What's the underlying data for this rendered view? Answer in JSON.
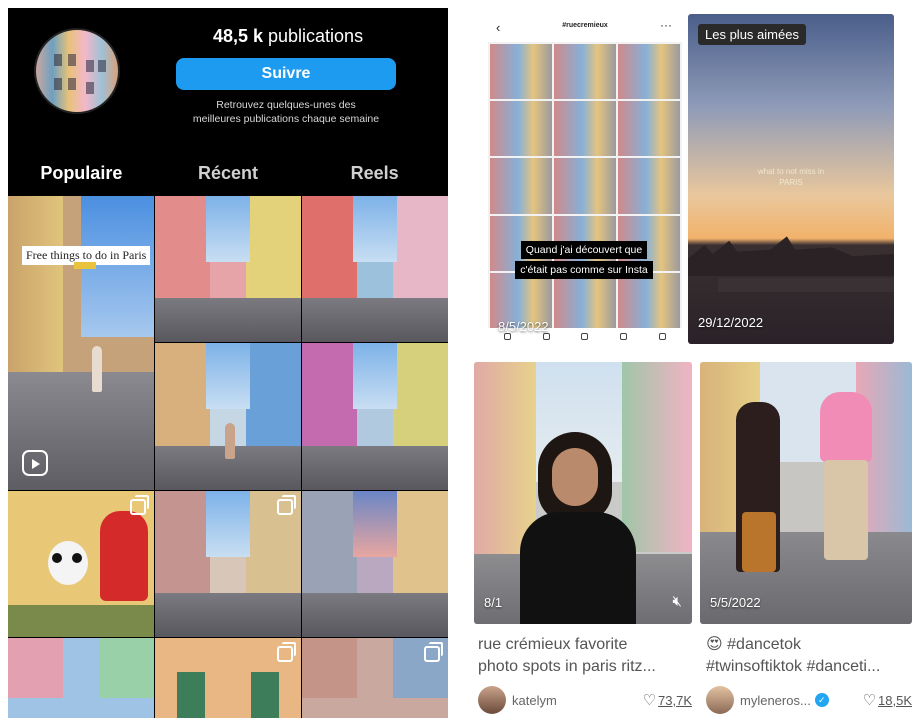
{
  "instagram": {
    "post_count": "48,5 k",
    "post_count_label": "publications",
    "follow_label": "Suivre",
    "subtitle_line1": "Retrouvez quelques-unes des",
    "subtitle_line2": "meilleures publications chaque semaine",
    "tabs": [
      {
        "label": "Populaire",
        "active": true
      },
      {
        "label": "Récent",
        "active": false
      },
      {
        "label": "Reels",
        "active": false
      }
    ],
    "grid_captions": {
      "first_post_caption": "Free things to do in Paris"
    },
    "icons": [
      "reels-icon",
      "multi-post-icon"
    ]
  },
  "tiktok": {
    "cards": [
      {
        "header_tag": "#ruecremieux",
        "overlay_line1": "Quand j'ai découvert que",
        "overlay_line2": "c'était pas comme sur Insta",
        "date": "8/5/2022"
      },
      {
        "badge": "Les plus aimées",
        "overlay_line1": "what to not miss in",
        "overlay_line2": "PARIS",
        "date": "29/12/2022"
      },
      {
        "date": "8/1",
        "title_line1": "rue crémieux favorite",
        "title_line2": "photo spots in paris ritz...",
        "author": "katelym",
        "likes": "73,7K"
      },
      {
        "date": "5/5/2022",
        "title_emoji": "😍",
        "title_line1": "#dancetok",
        "title_line2": "#twinsoftiktok #danceti...",
        "author": "myleneros...",
        "likes": "18,5K"
      }
    ],
    "colors": {
      "verified": "#22a6f2"
    }
  }
}
